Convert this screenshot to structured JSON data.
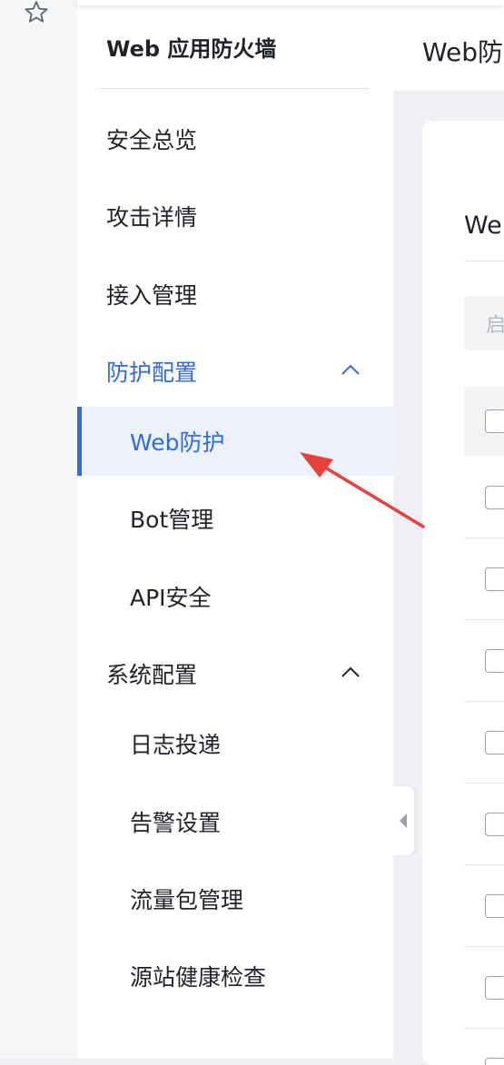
{
  "sidebar": {
    "title": "Web 应用防火墙",
    "items": [
      {
        "label": "安全总览"
      },
      {
        "label": "攻击详情"
      },
      {
        "label": "接入管理"
      },
      {
        "label": "防护配置"
      },
      {
        "label": "Web防护"
      },
      {
        "label": "Bot管理"
      },
      {
        "label": "API安全"
      },
      {
        "label": "系统配置"
      },
      {
        "label": "日志投递"
      },
      {
        "label": "告警设置"
      },
      {
        "label": "流量包管理"
      },
      {
        "label": "源站健康检查"
      }
    ],
    "selected_item": "Web防护",
    "expanded_groups": [
      "防护配置",
      "系统配置"
    ]
  },
  "main": {
    "page_title": "Web防",
    "card_title": "Web",
    "filter_placeholder": "启"
  },
  "colors": {
    "accent": "#2f6ae8",
    "selected_bg": "#ecf1fc",
    "annotation_arrow": "#e8413c"
  }
}
